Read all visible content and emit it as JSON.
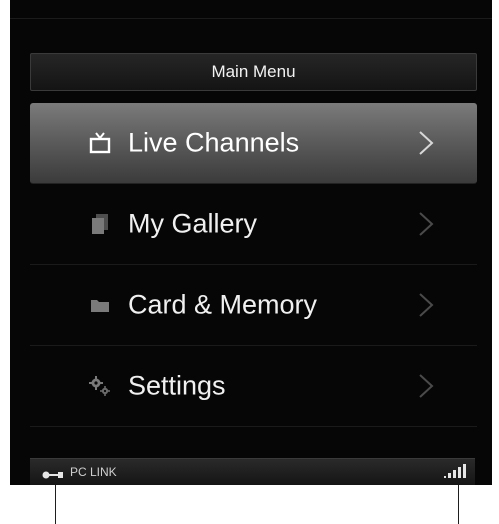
{
  "menu": {
    "title": "Main Menu",
    "items": [
      {
        "label": "Live Channels",
        "icon": "tv-icon",
        "selected": true
      },
      {
        "label": "My Gallery",
        "icon": "gallery-icon",
        "selected": false
      },
      {
        "label": "Card & Memory",
        "icon": "folder-icon",
        "selected": false
      },
      {
        "label": "Settings",
        "icon": "gears-icon",
        "selected": false
      }
    ]
  },
  "status": {
    "link_label": "PC LINK",
    "link_icon": "connector-icon",
    "signal_icon": "signal-strength-icon"
  },
  "colors": {
    "background": "#060606",
    "selected_top": "#7b7b7b",
    "selected_bottom": "#3b3b3b",
    "text": "#f0f0f0",
    "chevron_selected": "#d8d8d8",
    "chevron_dim": "#4a4a4a"
  }
}
